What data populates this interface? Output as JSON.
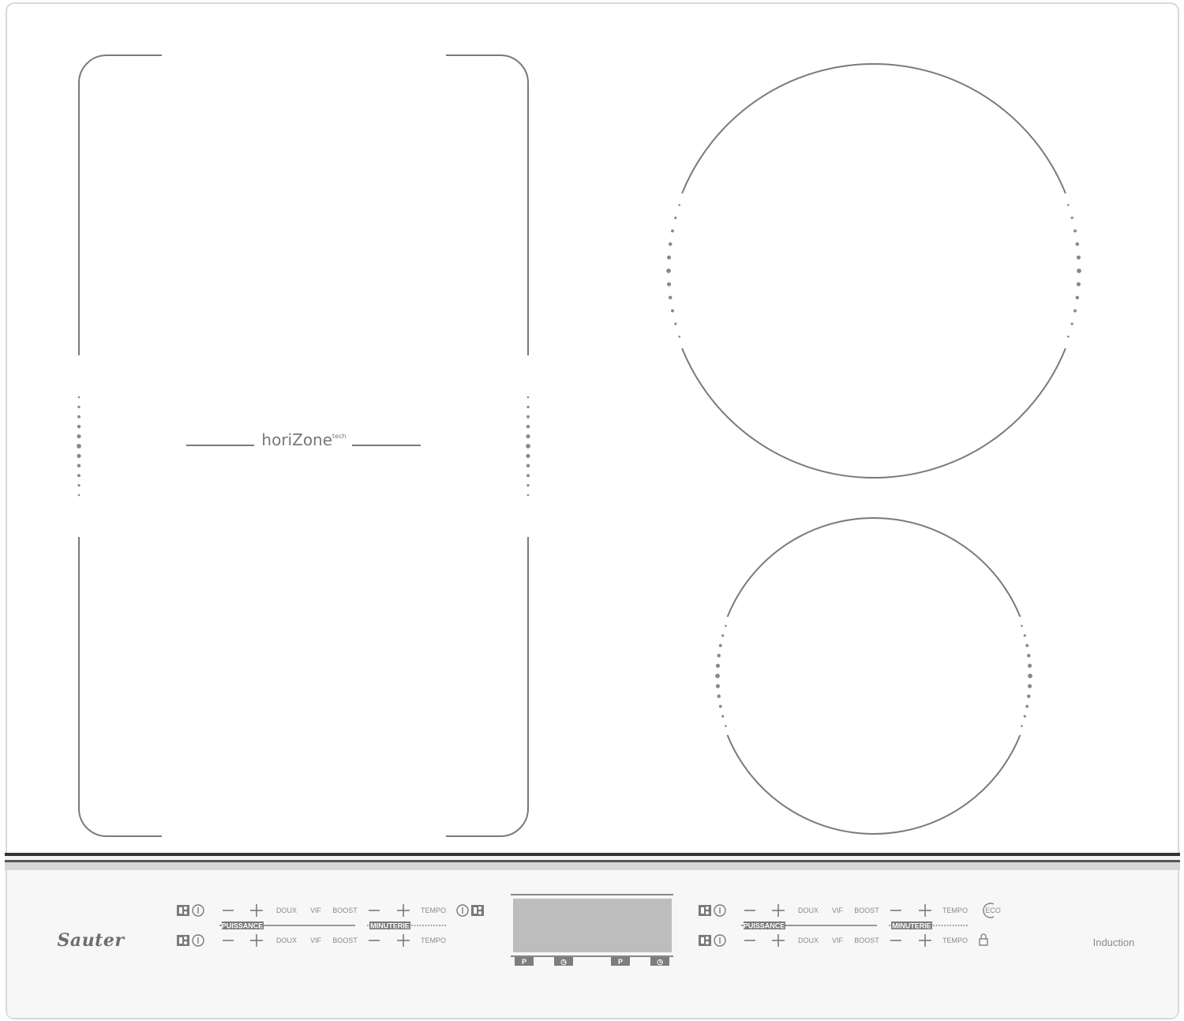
{
  "brand": {
    "logo": "Sauter",
    "zone_brand": "horiZone",
    "zone_brand_sup": "tech",
    "type_label": "Induction"
  },
  "colors": {
    "outline": "#7a7a7a",
    "panel": "#f7f7f7",
    "display": "#bdbdbd",
    "button": "#7d7d7d"
  },
  "controls": {
    "left": {
      "rows": [
        {
          "minus": "—",
          "plus": "+",
          "doux": "DOUX",
          "vif": "VIF",
          "boost": "BOOST",
          "timer_minus": "—",
          "timer_plus": "+",
          "tempo": "TEMPO",
          "extra_icon": "power-zone-icon"
        },
        {
          "minus": "—",
          "plus": "+",
          "doux": "DOUX",
          "vif": "VIF",
          "boost": "BOOST",
          "timer_minus": "—",
          "timer_plus": "+",
          "tempo": "TEMPO",
          "extra_icon": ""
        }
      ],
      "puissance": "PUISSANCE",
      "minuterie": "MINUTERIE"
    },
    "right": {
      "rows": [
        {
          "minus": "—",
          "plus": "+",
          "doux": "DOUX",
          "vif": "VIF",
          "boost": "BOOST",
          "timer_minus": "—",
          "timer_plus": "+",
          "tempo": "TEMPO",
          "extra_icon": "eco-icon",
          "extra_text": "ECO"
        },
        {
          "minus": "—",
          "plus": "+",
          "doux": "DOUX",
          "vif": "VIF",
          "boost": "BOOST",
          "timer_minus": "—",
          "timer_plus": "+",
          "tempo": "TEMPO",
          "extra_icon": "lock-icon"
        }
      ],
      "puissance": "PUISSANCE",
      "minuterie": "MINUTERIE"
    },
    "display_buttons": [
      {
        "label": "P",
        "icon": "pause-button"
      },
      {
        "label": "◷",
        "icon": "clock-icon"
      },
      {
        "label": "P",
        "icon": "pause-button"
      },
      {
        "label": "◷",
        "icon": "clock-icon"
      }
    ]
  }
}
